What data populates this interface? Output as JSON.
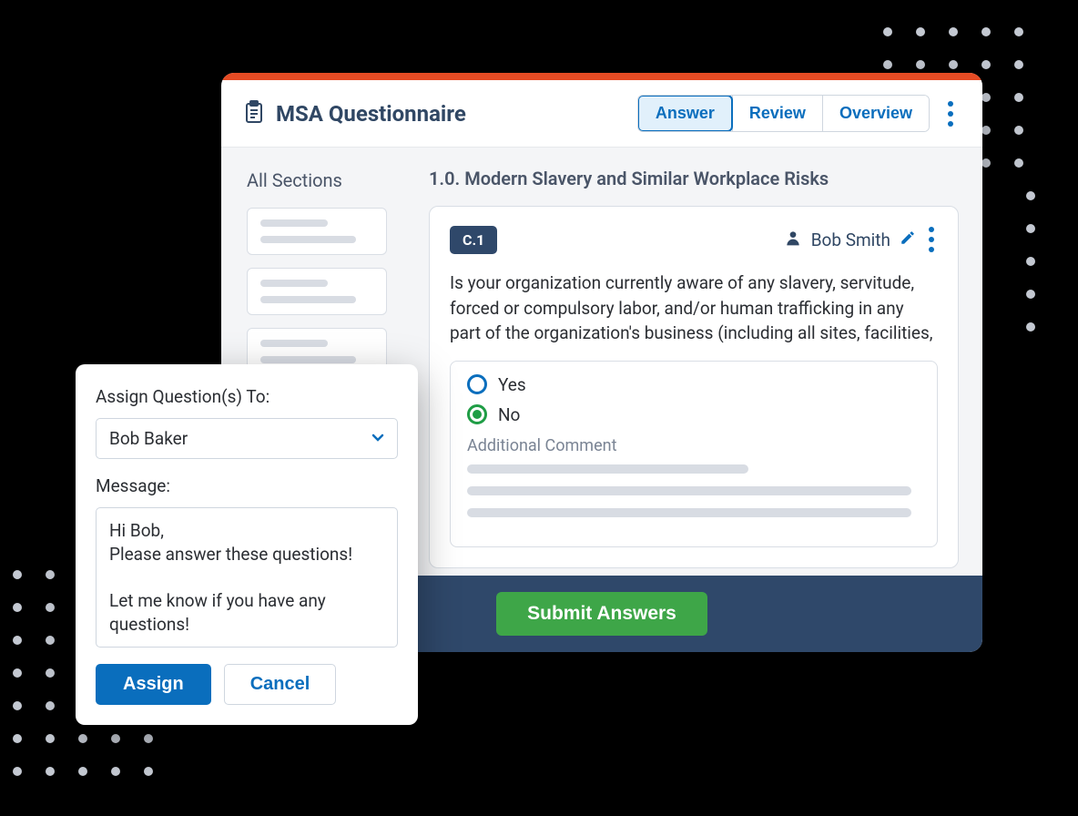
{
  "header": {
    "title": "MSA Questionnaire",
    "tabs": {
      "answer": "Answer",
      "review": "Review",
      "overview": "Overview"
    }
  },
  "sidebar": {
    "title": "All Sections"
  },
  "main": {
    "section_heading": "1.0. Modern Slavery and Similar Workplace Risks",
    "question": {
      "code": "C.1",
      "assignee": "Bob Smith",
      "text": "Is your organization currently aware of any slavery, servitude, forced or compulsory labor, and/or human trafficking in any part of the organization's business (including all sites, facilities,",
      "options": {
        "yes": "Yes",
        "no": "No"
      },
      "comment_label": "Additional Comment"
    }
  },
  "footer": {
    "submit": "Submit Answers"
  },
  "popover": {
    "assign_label": "Assign Question(s) To:",
    "selected_user": "Bob Baker",
    "message_label": "Message:",
    "message_body": "Hi Bob,\nPlease answer these questions!\n\nLet me know if you have any questions!",
    "assign_btn": "Assign",
    "cancel_btn": "Cancel"
  }
}
